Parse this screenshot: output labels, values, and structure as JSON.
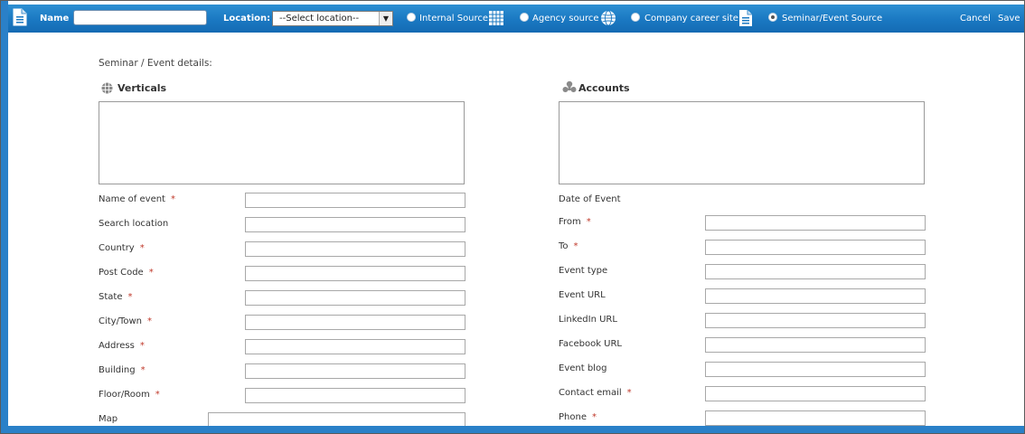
{
  "toolbar": {
    "name_label": "Name",
    "name_value": "",
    "location_label": "Location:",
    "location_selected": "--Select location--",
    "sources": [
      {
        "label": "Internal Source",
        "checked": false
      },
      {
        "label": "Agency source",
        "checked": false
      },
      {
        "label": "Company career site",
        "checked": false
      },
      {
        "label": "Seminar/Event Source",
        "checked": true
      }
    ],
    "cancel_label": "Cancel",
    "save_label": "Save"
  },
  "form": {
    "section_title": "Seminar / Event details:",
    "verticals_title": "Verticals",
    "accounts_title": "Accounts",
    "date_of_event_label": "Date of Event",
    "left_fields": [
      {
        "label": "Name of event",
        "required": true
      },
      {
        "label": "Search location",
        "required": false
      },
      {
        "label": "Country",
        "required": true
      },
      {
        "label": "Post Code",
        "required": true
      },
      {
        "label": "State",
        "required": true
      },
      {
        "label": "City/Town",
        "required": true
      },
      {
        "label": "Address",
        "required": true
      },
      {
        "label": "Building",
        "required": true
      },
      {
        "label": "Floor/Room",
        "required": true
      },
      {
        "label": "Map",
        "required": false
      }
    ],
    "right_fields": [
      {
        "label": "From",
        "required": true
      },
      {
        "label": "To",
        "required": true
      },
      {
        "label": "Event type",
        "required": false
      },
      {
        "label": "Event URL",
        "required": false
      },
      {
        "label": "LinkedIn URL",
        "required": false
      },
      {
        "label": "Facebook URL",
        "required": false
      },
      {
        "label": "Event blog",
        "required": false
      },
      {
        "label": "Contact email",
        "required": true
      },
      {
        "label": "Phone",
        "required": true
      }
    ],
    "required_marker": "*"
  },
  "colors": {
    "toolbar_blue": "#1a78c2",
    "required_red": "#c0392b"
  }
}
